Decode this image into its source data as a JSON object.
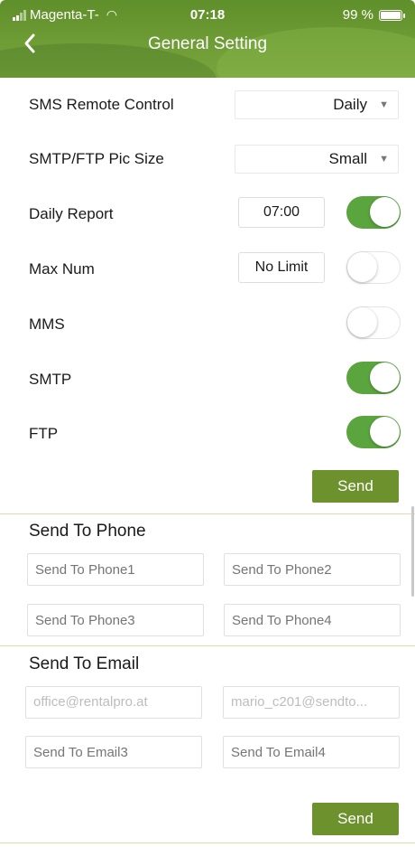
{
  "status_bar": {
    "carrier": "Magenta-T-",
    "time": "07:18",
    "battery": "99 %",
    "battery_level": 0.99
  },
  "nav": {
    "back_icon": "chevron-left-icon",
    "title": "General Setting"
  },
  "settings": {
    "sms_remote": {
      "label": "SMS Remote Control",
      "value": "Daily"
    },
    "pic_size": {
      "label": "SMTP/FTP Pic Size",
      "value": "Small"
    },
    "daily_report": {
      "label": "Daily Report",
      "time": "07:00",
      "enabled": true
    },
    "max_num": {
      "label": "Max Num",
      "value": "No Limit",
      "enabled": false
    },
    "mms": {
      "label": "MMS",
      "enabled": false
    },
    "smtp": {
      "label": "SMTP",
      "enabled": true
    },
    "ftp": {
      "label": "FTP",
      "enabled": true
    },
    "send_label": "Send"
  },
  "phone": {
    "title": "Send To Phone",
    "fields": [
      {
        "placeholder": "Send To Phone1",
        "value": ""
      },
      {
        "placeholder": "Send To Phone2",
        "value": ""
      },
      {
        "placeholder": "Send To Phone3",
        "value": ""
      },
      {
        "placeholder": "Send To Phone4",
        "value": ""
      }
    ]
  },
  "email": {
    "title": "Send To Email",
    "fields": [
      {
        "placeholder": "",
        "value": "office@rentalpro.at"
      },
      {
        "placeholder": "",
        "value": "mario_c201@sendto..."
      },
      {
        "placeholder": "Send To Email3",
        "value": ""
      },
      {
        "placeholder": "Send To Email4",
        "value": ""
      }
    ],
    "send_label": "Send"
  },
  "colors": {
    "accent": "#6d912d",
    "toggle_on": "#5aa53e",
    "header": "#6e9c35"
  }
}
